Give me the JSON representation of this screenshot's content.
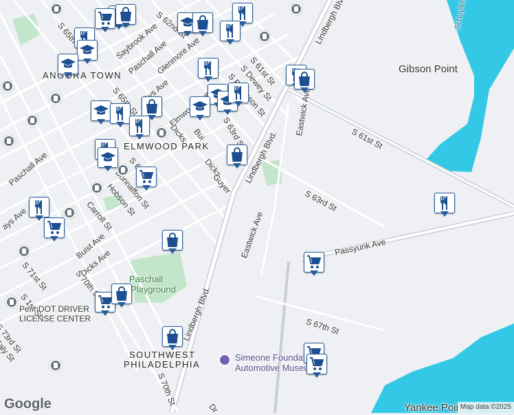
{
  "attribution": "Map data ©2025",
  "logo": "Google",
  "areas": [
    {
      "text": "ANGORA TOWN",
      "kind": "area"
    },
    {
      "text": "ELMWOOD PARK",
      "kind": "area"
    },
    {
      "text": "SOUTHWEST",
      "kind": "area"
    },
    {
      "text": "PHILADELPHIA",
      "kind": "area"
    },
    {
      "text": "Gibson Point",
      "kind": "place"
    },
    {
      "text": "Yankee Point",
      "kind": "place"
    },
    {
      "text": "Schuylkill",
      "kind": "water"
    }
  ],
  "pois": [
    {
      "text": "Paschall",
      "kind": "park"
    },
    {
      "text": "Playground",
      "kind": "park"
    },
    {
      "text": "PennDOT DRIVER",
      "kind": "poi"
    },
    {
      "text": "LICENSE CENTER",
      "kind": "poi"
    },
    {
      "text": "Simeone Foundation",
      "kind": "museum"
    },
    {
      "text": "Automotive Museum",
      "kind": "museum"
    }
  ],
  "streets": [
    "S 65th St",
    "Saybrook Ave",
    "Paschall Ave",
    "Glenmore Ave",
    "S 62nd St",
    "S 61st St",
    "S Dewey St",
    "S Robinson St",
    "Lindbergh Blvd.",
    "Elmwood Ave",
    "Ays Ave",
    "S 65th St",
    "Dicks",
    "Bui",
    "S 63rd St",
    "Dicks",
    "Guyer",
    "Lindbergh Blvd.",
    "Eastwick Ave",
    "S 61st St",
    "S 66th St",
    "Bonnaffon St",
    "Hobson St",
    "Paschall Ave",
    "Carroll St",
    "Buist Ave",
    "Dicks Ave",
    "S 70th St",
    "S 71st St",
    "S 73rd St",
    "Ealy St",
    "Lindbergh Blvd.",
    "S 70th St",
    "Eastwick Ave",
    "S 63rd St",
    "Passyunk Ave",
    "S 67th St",
    "Dr",
    "ays Ave",
    "S 1st St"
  ],
  "markers": [
    {
      "icon": "restaurant"
    },
    {
      "icon": "grocery"
    },
    {
      "icon": "shopping"
    },
    {
      "icon": "restaurant"
    },
    {
      "icon": "school"
    },
    {
      "icon": "shopping"
    },
    {
      "icon": "restaurant"
    },
    {
      "icon": "school"
    },
    {
      "icon": "school"
    },
    {
      "icon": "restaurant"
    },
    {
      "icon": "restaurant"
    },
    {
      "icon": "school"
    },
    {
      "icon": "school"
    },
    {
      "icon": "restaurant"
    },
    {
      "icon": "restaurant"
    },
    {
      "icon": "shopping"
    },
    {
      "icon": "school"
    },
    {
      "icon": "restaurant"
    },
    {
      "icon": "shopping"
    },
    {
      "icon": "restaurant"
    },
    {
      "icon": "restaurant"
    },
    {
      "icon": "school"
    },
    {
      "icon": "school"
    },
    {
      "icon": "restaurant"
    },
    {
      "icon": "grocery"
    },
    {
      "icon": "shopping"
    },
    {
      "icon": "shopping"
    },
    {
      "icon": "grocery"
    },
    {
      "icon": "grocery"
    }
  ],
  "colors": {
    "water": "#33c9e6",
    "land": "#eef0f3",
    "park": "#c3e6cb",
    "road": "#ffffff",
    "highway": "#c9ced6",
    "marker_border": "#2a5d9c",
    "icon": "#1d4f91"
  }
}
